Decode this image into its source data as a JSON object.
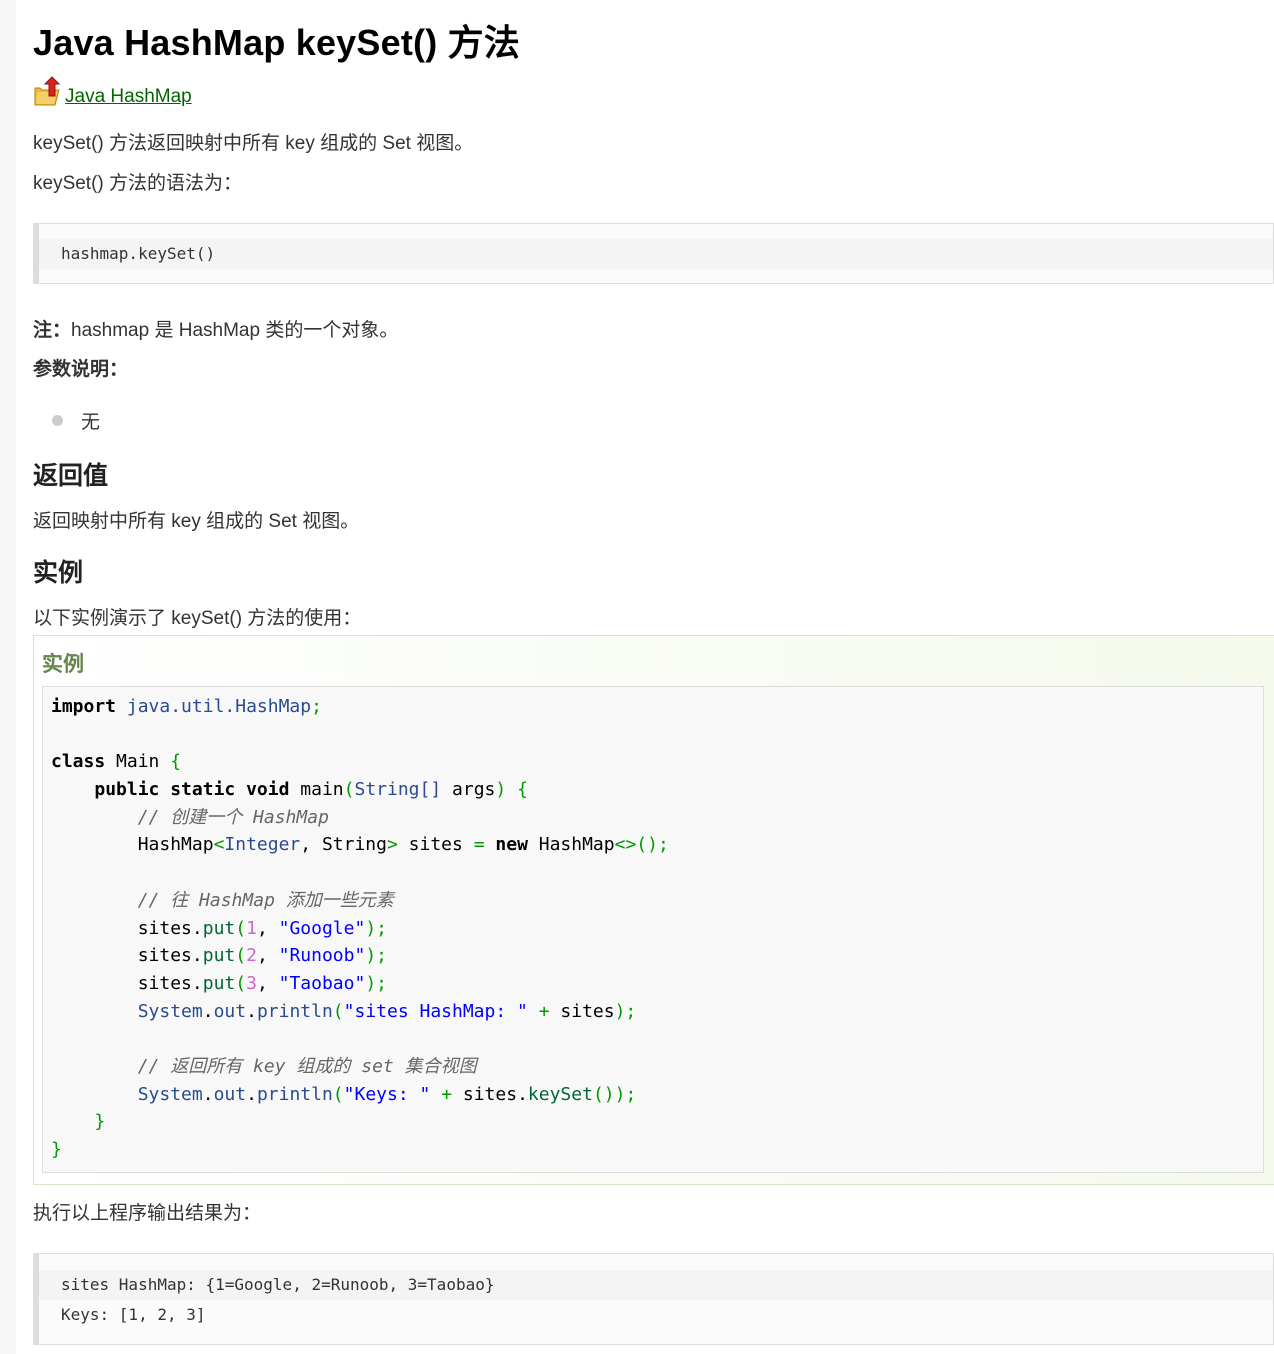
{
  "title": "Java HashMap keySet() 方法",
  "back_link": "Java HashMap",
  "intro": "keySet() 方法返回映射中所有 key 组成的 Set 视图。",
  "syntax_intro": "keySet() 方法的语法为：",
  "syntax_code": "hashmap.keySet()",
  "note_label": "注：",
  "note_text": "hashmap 是 HashMap 类的一个对象。",
  "params_heading": "参数说明：",
  "params": [
    "无"
  ],
  "return_heading": "返回值",
  "return_text": "返回映射中所有 key 组成的 Set 视图。",
  "example_heading": "实例",
  "example_intro": "以下实例演示了 keySet() 方法的使用：",
  "example_box_title": "实例",
  "code": {
    "import_kw": "import",
    "import_pkg": "java.util.HashMap",
    "class_kw": "class",
    "class_name": "Main",
    "main_sig_kw": "public static void",
    "main_name": "main",
    "main_type": "String[]",
    "main_arg": "args",
    "comment1": "// 创建一个 HashMap",
    "decl_type": "HashMap",
    "decl_gen1": "Integer",
    "decl_gen2": "String",
    "decl_var": "sites",
    "decl_new": "new",
    "comment2": "// 往 HashMap 添加一些元素",
    "puts": [
      {
        "num": "1",
        "str": "\"Google\""
      },
      {
        "num": "2",
        "str": "\"Runoob\""
      },
      {
        "num": "3",
        "str": "\"Taobao\""
      }
    ],
    "print1_str": "\"sites HashMap: \"",
    "comment3": "// 返回所有 key 组成的 set 集合视图",
    "print2_str": "\"Keys: \""
  },
  "output_intro": "执行以上程序输出结果为：",
  "output_lines": [
    "sites HashMap: {1=Google, 2=Runoob, 3=Taobao}",
    "Keys: [1, 2, 3]"
  ]
}
